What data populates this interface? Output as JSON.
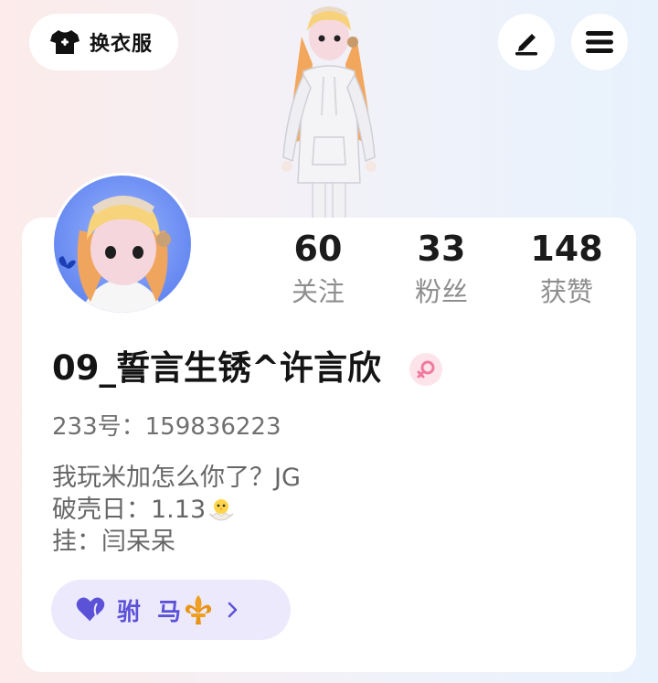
{
  "toolbar": {
    "wardrobe_label": "换衣服",
    "wardrobe_icon": "tshirt-icon",
    "edit_icon": "pen-icon",
    "menu_icon": "menu-icon"
  },
  "profile": {
    "stats": [
      {
        "value": "60",
        "label": "关注"
      },
      {
        "value": "33",
        "label": "粉丝"
      },
      {
        "value": "148",
        "label": "获赞"
      }
    ],
    "username": "09_誓言生锈^许言欣",
    "gender_icon": "female-icon",
    "gender_color": "#f07aa0",
    "uid": "233号：159836223",
    "bio": {
      "line1": "我玩米加怎么你了？JG",
      "line2": "破壳日：1.13",
      "line3": "挂：闫呆呆"
    },
    "medal": {
      "name": "驸  马",
      "color": "#5c52d8",
      "background": "#ebe9fb"
    }
  }
}
